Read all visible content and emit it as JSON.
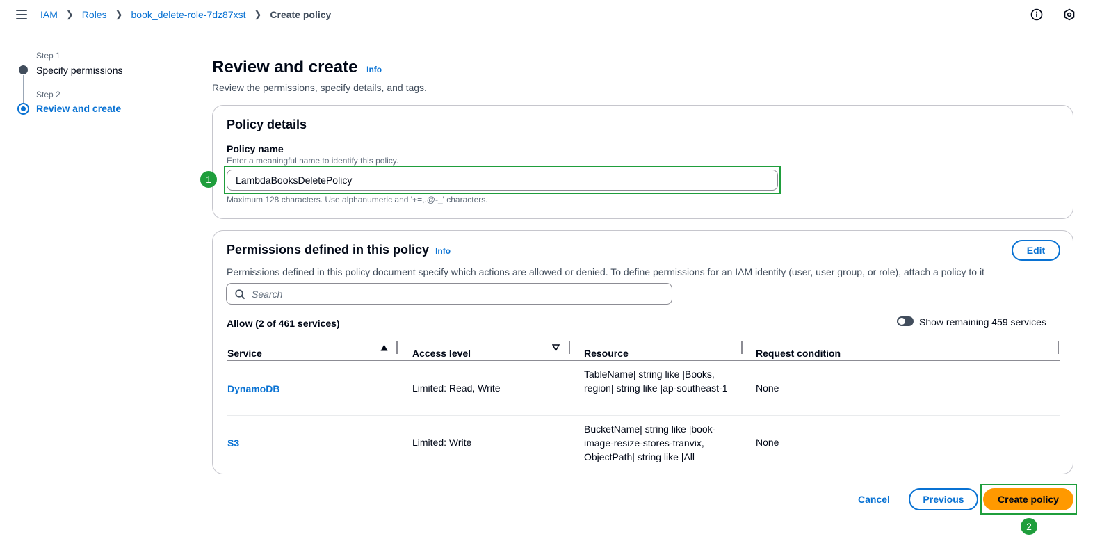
{
  "breadcrumb": {
    "items": [
      "IAM",
      "Roles",
      "book_delete-role-7dz87xst"
    ],
    "current": "Create policy"
  },
  "icons": {
    "menu": "menu-icon",
    "info": "info-circle-icon",
    "settings": "notifications-icon"
  },
  "steps": [
    {
      "label": "Step 1",
      "title": "Specify permissions"
    },
    {
      "label": "Step 2",
      "title": "Review and create"
    }
  ],
  "page": {
    "title": "Review and create",
    "info": "Info",
    "subtitle": "Review the permissions, specify details, and tags."
  },
  "policy_details": {
    "heading": "Policy details",
    "name_label": "Policy name",
    "name_description": "Enter a meaningful name to identify this policy.",
    "name_value": "LambdaBooksDeletePolicy",
    "name_constraint": "Maximum 128 characters. Use alphanumeric and '+=,.@-_' characters."
  },
  "permissions": {
    "heading": "Permissions defined in this policy",
    "info": "Info",
    "edit_label": "Edit",
    "description": "Permissions defined in this policy document specify which actions are allowed or denied. To define permissions for an IAM identity (user, user group, or role), attach a policy to it",
    "search_placeholder": "Search",
    "allow_summary": "Allow (2 of 461 services)",
    "show_remaining": "Show remaining 459 services",
    "columns": [
      "Service",
      "Access level",
      "Resource",
      "Request condition"
    ],
    "rows": [
      {
        "service": "DynamoDB",
        "access": "Limited: Read, Write",
        "resource": "TableName| string like |Books, region| string like |ap-southeast-1",
        "condition": "None"
      },
      {
        "service": "S3",
        "access": "Limited: Write",
        "resource": "BucketName| string like |book-image-resize-stores-tranvix, ObjectPath| string like |All",
        "condition": "None"
      }
    ]
  },
  "footer": {
    "cancel": "Cancel",
    "previous": "Previous",
    "create": "Create policy"
  },
  "annotations": [
    "1",
    "2"
  ],
  "colors": {
    "accent": "#0972d3",
    "primary_button": "#ff9900",
    "highlight": "#1f9e3c"
  }
}
